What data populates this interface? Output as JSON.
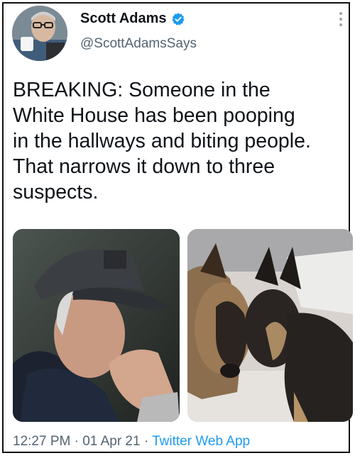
{
  "user": {
    "display_name": "Scott Adams",
    "handle": "@ScottAdamsSays",
    "verified": true,
    "avatar_icon": "profile-photo-avatar"
  },
  "tweet": {
    "text": "BREAKING: Someone in the\nWhite House has been pooping\nin the hallways and biting people.\nThat narrows it down to three\nsuspects."
  },
  "media": [
    {
      "icon": "photo-man-in-cap"
    },
    {
      "icon": "photo-two-german-shepherd-dogs"
    }
  ],
  "meta": {
    "time": "12:27 PM",
    "separator": "·",
    "date": "01 Apr 21",
    "source": "Twitter Web App"
  },
  "colors": {
    "verified_blue": "#1d9bf0",
    "link_blue": "#1d9bf0",
    "secondary_text": "#536471"
  }
}
